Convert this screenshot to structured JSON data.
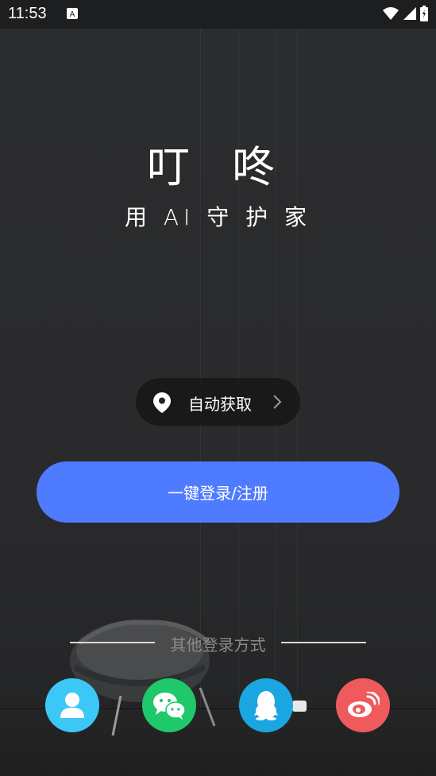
{
  "status_bar": {
    "time": "11:53",
    "icons": [
      "a-notification-icon",
      "wifi-icon",
      "cell-signal-icon",
      "battery-icon"
    ]
  },
  "app": {
    "title": "叮 咚",
    "subtitle": "用 AI 守 护 家"
  },
  "location": {
    "icon": "location-pin-icon",
    "label": "自动获取",
    "chevron": "chevron-right-icon"
  },
  "login": {
    "label": "一键登录/注册",
    "color": "#4e7bff"
  },
  "other_login": {
    "label": "其他登录方式",
    "options": [
      {
        "name": "account",
        "icon": "user-icon",
        "color": "#3cc8f6"
      },
      {
        "name": "wechat",
        "icon": "wechat-icon",
        "color": "#1fc86a"
      },
      {
        "name": "qq",
        "icon": "qq-penguin-icon",
        "color": "#1aa6e0"
      },
      {
        "name": "weibo",
        "icon": "weibo-icon",
        "color": "#ef5a5d"
      }
    ]
  }
}
